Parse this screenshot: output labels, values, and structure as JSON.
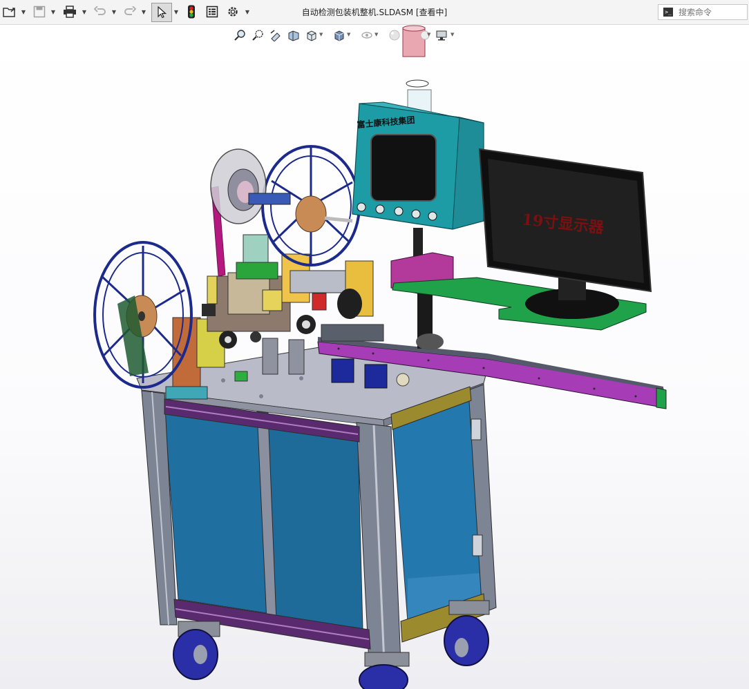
{
  "window": {
    "title": "自动检测包装机整机.SLDASM [查看中]"
  },
  "toolbar": {
    "items": [
      {
        "icon": "open-folder-icon"
      },
      {
        "icon": "save-icon"
      },
      {
        "icon": "print-icon"
      },
      {
        "icon": "undo-icon"
      },
      {
        "icon": "redo-icon"
      },
      {
        "icon": "select-arrow-icon"
      },
      {
        "icon": "traffic-light-icon"
      },
      {
        "icon": "file-properties-icon"
      },
      {
        "icon": "options-gear-icon"
      }
    ]
  },
  "search": {
    "placeholder": "搜索命令"
  },
  "heads_up_toolbar": {
    "items": [
      {
        "icon": "zoom-to-fit-icon"
      },
      {
        "icon": "zoom-to-area-icon"
      },
      {
        "icon": "previous-view-icon"
      },
      {
        "icon": "section-view-icon"
      },
      {
        "icon": "view-orientation-icon"
      },
      {
        "icon": "display-style-icon"
      },
      {
        "icon": "hide-show-items-icon"
      },
      {
        "icon": "edit-appearance-icon"
      },
      {
        "icon": "apply-scene-icon"
      },
      {
        "icon": "view-settings-icon"
      }
    ]
  },
  "model": {
    "panel_label": "富士康科技集团",
    "monitor_label": "19寸显示器",
    "colors": {
      "frame": "#7d8494",
      "door_panel": "#1f6fa0",
      "top_plate": "#b9bcc8",
      "reel": "#1c2a8c",
      "rail": "#a63db7",
      "control_box": "#1e9ca6",
      "monitor": "#1a1a1a",
      "green_plate": "#1fa24a",
      "tape": "#b5187f",
      "wheel": "#2a2fa8"
    }
  }
}
